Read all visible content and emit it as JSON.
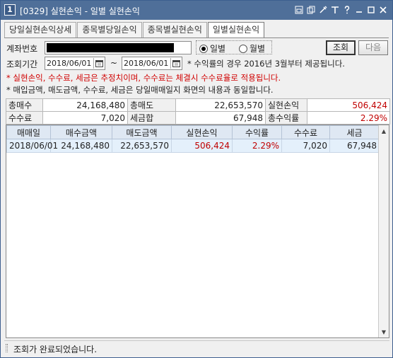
{
  "window": {
    "number": "1",
    "title": "[0329] 실현손익 - 일별 실현손익",
    "icons": [
      "restore-layout-icon",
      "copy-window-icon",
      "settings-icon",
      "font-size-icon",
      "help-icon",
      "minimize-icon",
      "maximize-icon",
      "close-icon"
    ]
  },
  "tabs": [
    {
      "label": "당일실현손익상세",
      "active": false
    },
    {
      "label": "종목별당일손익",
      "active": false
    },
    {
      "label": "종목별실현손익",
      "active": false
    },
    {
      "label": "일별실현손익",
      "active": true
    }
  ],
  "form": {
    "account_label": "계좌번호",
    "account_value": "",
    "radio_daily": "일별",
    "radio_monthly": "월별",
    "radio_selected": "daily",
    "query_button": "조회",
    "next_button": "다음",
    "period_label": "조회기간",
    "date_from": "2018/06/01",
    "date_sep": "~",
    "date_to": "2018/06/01",
    "period_note": "* 수익률의 경우 2016년 3월부터 제공됩니다."
  },
  "notes": {
    "red": "* 실현손익, 수수료, 세금은 추정치이며, 수수료는 체결시 수수료율로 적용됩니다.",
    "black": "* 매입금액, 매도금액, 수수료, 세금은 당일매매일지 화면의 내용과 동일합니다."
  },
  "summary": {
    "row1": [
      {
        "label": "총매수",
        "value": "24,168,480"
      },
      {
        "label": "총매도",
        "value": "22,653,570"
      },
      {
        "label": "실현손익",
        "value": "506,424"
      }
    ],
    "row2": [
      {
        "label": "수수료",
        "value": "7,020"
      },
      {
        "label": "세금합",
        "value": "67,948"
      },
      {
        "label": "총수익률",
        "value": "2.29%"
      }
    ]
  },
  "grid": {
    "columns": [
      "매매일",
      "매수금액",
      "매도금액",
      "실현손익",
      "수익률",
      "수수료",
      "세금"
    ],
    "rows": [
      [
        "2018/06/01",
        "24,168,480",
        "22,653,570",
        "506,424",
        "2.29%",
        "7,020",
        "67,948"
      ]
    ]
  },
  "status": {
    "text": "조회가 완료되었습니다."
  },
  "colors": {
    "titlebar": "#4f6f99",
    "profit_red": "#c00000",
    "note_red": "#d00000",
    "grid_header": "#dfe8f3",
    "grid_row": "#e4f0fb"
  }
}
